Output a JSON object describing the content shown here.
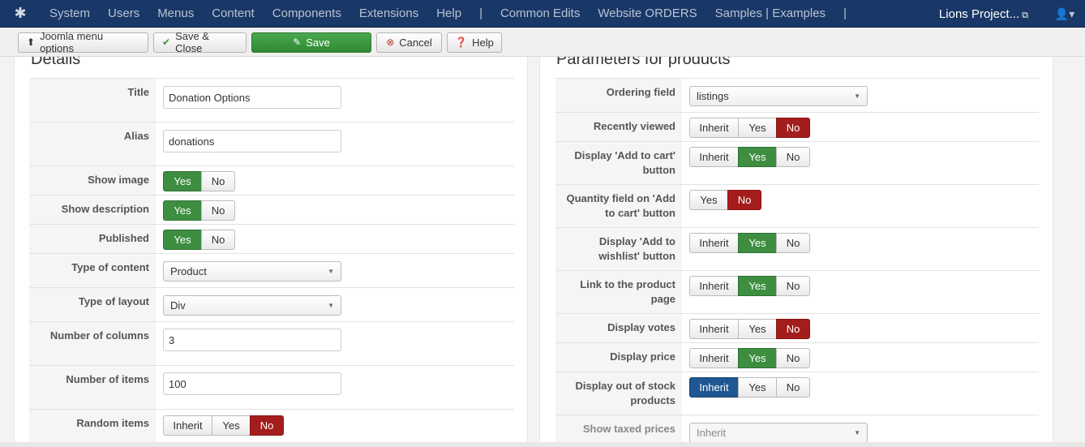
{
  "topnav": {
    "menu": [
      "System",
      "Users",
      "Menus",
      "Content",
      "Components",
      "Extensions",
      "Help"
    ],
    "separator": "|",
    "extra_links": [
      "Common Edits",
      "Website ORDERS",
      "Samples | Examples"
    ],
    "site_name": "Lions Project...",
    "icons": {
      "logo": "joomla-logo-icon",
      "external": "external-link-icon",
      "user": "user-icon"
    }
  },
  "toolbar": {
    "menu_options_label": "Joomla menu options",
    "save_close_label": "Save & Close",
    "save_label": "Save",
    "cancel_label": "Cancel",
    "help_label": "Help"
  },
  "left": {
    "legend": "Details",
    "fields": {
      "title": {
        "label": "Title",
        "value": "Donation Options"
      },
      "alias": {
        "label": "Alias",
        "value": "donations"
      },
      "show_image": {
        "label": "Show image",
        "yes": "Yes",
        "no": "No"
      },
      "show_description": {
        "label": "Show description",
        "yes": "Yes",
        "no": "No"
      },
      "published": {
        "label": "Published",
        "yes": "Yes",
        "no": "No"
      },
      "type_of_content": {
        "label": "Type of content",
        "value": "Product"
      },
      "type_of_layout": {
        "label": "Type of layout",
        "value": "Div"
      },
      "number_of_columns": {
        "label": "Number of columns",
        "value": "3"
      },
      "number_of_items": {
        "label": "Number of items",
        "value": "100"
      },
      "random_items": {
        "label": "Random items",
        "inherit": "Inherit",
        "yes": "Yes",
        "no": "No"
      }
    }
  },
  "right": {
    "legend": "Parameters for products",
    "fields": {
      "ordering_field": {
        "label": "Ordering field",
        "value": "listings"
      },
      "recently_viewed": {
        "label": "Recently viewed",
        "inherit": "Inherit",
        "yes": "Yes",
        "no": "No"
      },
      "display_add_to_cart": {
        "label": "Display 'Add to cart' button",
        "inherit": "Inherit",
        "yes": "Yes",
        "no": "No"
      },
      "quantity_field": {
        "label": "Quantity field on 'Add to cart' button",
        "yes": "Yes",
        "no": "No"
      },
      "display_add_to_wishlist": {
        "label": "Display 'Add to wishlist' button",
        "inherit": "Inherit",
        "yes": "Yes",
        "no": "No"
      },
      "link_to_product_page": {
        "label": "Link to the product page",
        "inherit": "Inherit",
        "yes": "Yes",
        "no": "No"
      },
      "display_votes": {
        "label": "Display votes",
        "inherit": "Inherit",
        "yes": "Yes",
        "no": "No"
      },
      "display_price": {
        "label": "Display price",
        "inherit": "Inherit",
        "yes": "Yes",
        "no": "No"
      },
      "display_out_of_stock": {
        "label": "Display out of stock products",
        "inherit": "Inherit",
        "yes": "Yes",
        "no": "No"
      },
      "show_taxed_prices": {
        "label": "Show taxed prices",
        "value": "Inherit"
      }
    }
  },
  "colors": {
    "nav_bg": "#1a3867",
    "yes_active": "#3e8e41",
    "no_active": "#a41d1d",
    "inherit_active": "#1f5792",
    "save_btn": "#3a9a3e"
  }
}
